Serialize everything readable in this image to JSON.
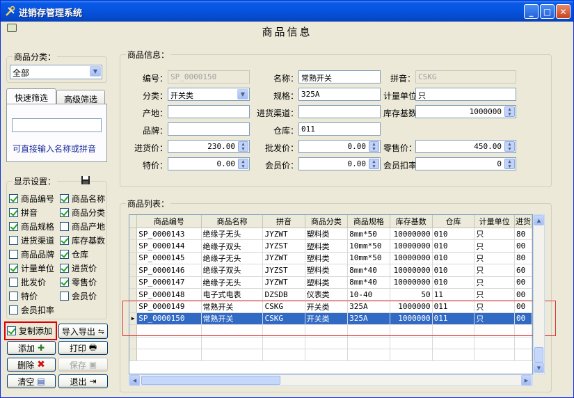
{
  "window": {
    "title": "进销存管理系统"
  },
  "page_title": "商品信息",
  "category": {
    "label": "商品分类：",
    "value": "全部"
  },
  "filter_tabs": {
    "quick": "快速筛选",
    "advanced": "高级筛选"
  },
  "quick_filter": {
    "value": "",
    "hint": "可直接输入名称或拼音"
  },
  "display_settings": {
    "label": "显示设置：",
    "items": [
      {
        "label": "商品编号",
        "checked": true
      },
      {
        "label": "商品名称",
        "checked": true
      },
      {
        "label": "拼音",
        "checked": true
      },
      {
        "label": "商品分类",
        "checked": true
      },
      {
        "label": "商品规格",
        "checked": true
      },
      {
        "label": "商品产地",
        "checked": false
      },
      {
        "label": "进货渠道",
        "checked": false
      },
      {
        "label": "库存基数",
        "checked": true
      },
      {
        "label": "商品品牌",
        "checked": false
      },
      {
        "label": "仓库",
        "checked": true
      },
      {
        "label": "计量单位",
        "checked": true
      },
      {
        "label": "进货价",
        "checked": true
      },
      {
        "label": "批发价",
        "checked": false
      },
      {
        "label": "零售价",
        "checked": true
      },
      {
        "label": "特价",
        "checked": false
      },
      {
        "label": "会员价",
        "checked": false
      },
      {
        "label": "会员扣率",
        "checked": false
      }
    ]
  },
  "copy_add": {
    "label": "复制添加",
    "checked": true
  },
  "buttons": {
    "import_export": "导入导出",
    "add": "添加",
    "print": "打印",
    "delete": "删除",
    "save": "保存",
    "clear": "清空",
    "exit": "退出"
  },
  "product_info": {
    "legend": "商品信息：",
    "code_label": "编号：",
    "code": "SP_0000150",
    "name_label": "名称：",
    "name": "常熟开关",
    "pinyin_label": "拼音：",
    "pinyin": "CSKG",
    "category_label": "分类：",
    "category": "开关类",
    "spec_label": "规格：",
    "spec": "325A",
    "unit_label": "计量单位：",
    "unit": "只",
    "origin_label": "产地：",
    "origin": "",
    "channel_label": "进货渠道：",
    "channel": "",
    "stock_label": "库存基数：",
    "stock": "1000000",
    "brand_label": "品牌：",
    "brand": "",
    "warehouse_label": "仓库：",
    "warehouse": "011",
    "purchase_label": "进货价：",
    "purchase": "230.00",
    "wholesale_label": "批发价：",
    "wholesale": "0.00",
    "retail_label": "零售价：",
    "retail": "450.00",
    "special_label": "特价：",
    "special": "0.00",
    "member_label": "会员价：",
    "member": "0.00",
    "discount_label": "会员扣率：",
    "discount": "0"
  },
  "product_list": {
    "legend": "商品列表：",
    "columns": [
      "商品编号",
      "商品名称",
      "拼音",
      "商品分类",
      "商品规格",
      "库存基数",
      "仓库",
      "计量单位",
      "进货"
    ],
    "rows": [
      [
        "SP_0000143",
        "绝缘子无头",
        "JYZWT",
        "塑料类",
        "8mm*50",
        "10000000",
        "010",
        "只",
        "80"
      ],
      [
        "SP_0000144",
        "绝缘子双头",
        "JYZST",
        "塑料类",
        "10mm*50",
        "10000000",
        "010",
        "只",
        "00"
      ],
      [
        "SP_0000145",
        "绝缘子无头",
        "JYZWT",
        "塑料类",
        "10mm*50",
        "10000000",
        "010",
        "只",
        "80"
      ],
      [
        "SP_0000146",
        "绝缘子双头",
        "JYZST",
        "塑料类",
        "8mm*40",
        "10000000",
        "010",
        "只",
        "60"
      ],
      [
        "SP_0000147",
        "绝缘子无头",
        "JYZWT",
        "塑料类",
        "8mm*40",
        "10000000",
        "010",
        "只",
        "00"
      ],
      [
        "SP_0000148",
        "电子式电表",
        "DZSDB",
        "仪表类",
        "10-40",
        "50",
        "11",
        "只",
        "00"
      ],
      [
        "SP_0000149",
        "常熟开关",
        "CSKG",
        "开关类",
        "325A",
        "1000000",
        "011",
        "只",
        "00"
      ],
      [
        "SP_0000150",
        "常熟开关",
        "CSKG",
        "开关类",
        "325A",
        "1000000",
        "011",
        "只",
        "00"
      ]
    ],
    "selected_row": 7
  }
}
